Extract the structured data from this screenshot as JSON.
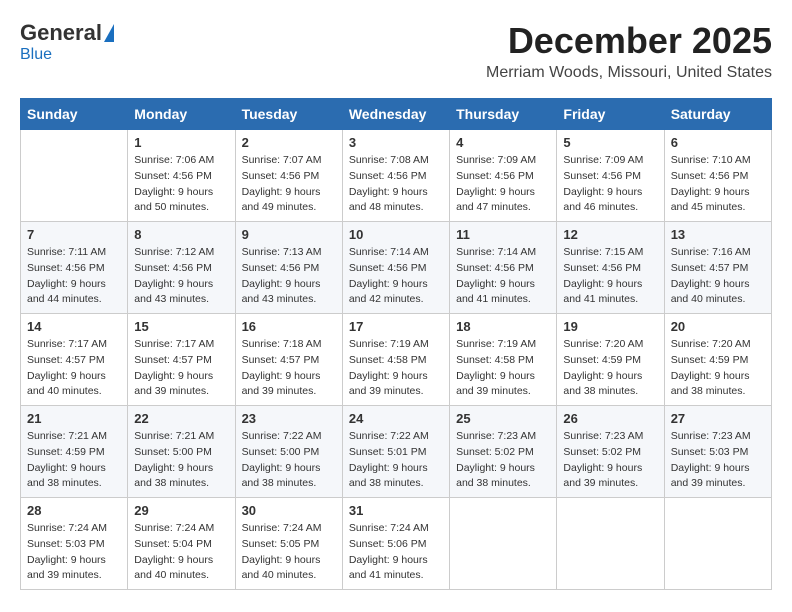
{
  "logo": {
    "general": "General",
    "blue": "Blue"
  },
  "title": {
    "month": "December 2025",
    "location": "Merriam Woods, Missouri, United States"
  },
  "days_of_week": [
    "Sunday",
    "Monday",
    "Tuesday",
    "Wednesday",
    "Thursday",
    "Friday",
    "Saturday"
  ],
  "weeks": [
    [
      {
        "day": "",
        "info": ""
      },
      {
        "day": "1",
        "info": "Sunrise: 7:06 AM\nSunset: 4:56 PM\nDaylight: 9 hours\nand 50 minutes."
      },
      {
        "day": "2",
        "info": "Sunrise: 7:07 AM\nSunset: 4:56 PM\nDaylight: 9 hours\nand 49 minutes."
      },
      {
        "day": "3",
        "info": "Sunrise: 7:08 AM\nSunset: 4:56 PM\nDaylight: 9 hours\nand 48 minutes."
      },
      {
        "day": "4",
        "info": "Sunrise: 7:09 AM\nSunset: 4:56 PM\nDaylight: 9 hours\nand 47 minutes."
      },
      {
        "day": "5",
        "info": "Sunrise: 7:09 AM\nSunset: 4:56 PM\nDaylight: 9 hours\nand 46 minutes."
      },
      {
        "day": "6",
        "info": "Sunrise: 7:10 AM\nSunset: 4:56 PM\nDaylight: 9 hours\nand 45 minutes."
      }
    ],
    [
      {
        "day": "7",
        "info": "Sunrise: 7:11 AM\nSunset: 4:56 PM\nDaylight: 9 hours\nand 44 minutes."
      },
      {
        "day": "8",
        "info": "Sunrise: 7:12 AM\nSunset: 4:56 PM\nDaylight: 9 hours\nand 43 minutes."
      },
      {
        "day": "9",
        "info": "Sunrise: 7:13 AM\nSunset: 4:56 PM\nDaylight: 9 hours\nand 43 minutes."
      },
      {
        "day": "10",
        "info": "Sunrise: 7:14 AM\nSunset: 4:56 PM\nDaylight: 9 hours\nand 42 minutes."
      },
      {
        "day": "11",
        "info": "Sunrise: 7:14 AM\nSunset: 4:56 PM\nDaylight: 9 hours\nand 41 minutes."
      },
      {
        "day": "12",
        "info": "Sunrise: 7:15 AM\nSunset: 4:56 PM\nDaylight: 9 hours\nand 41 minutes."
      },
      {
        "day": "13",
        "info": "Sunrise: 7:16 AM\nSunset: 4:57 PM\nDaylight: 9 hours\nand 40 minutes."
      }
    ],
    [
      {
        "day": "14",
        "info": "Sunrise: 7:17 AM\nSunset: 4:57 PM\nDaylight: 9 hours\nand 40 minutes."
      },
      {
        "day": "15",
        "info": "Sunrise: 7:17 AM\nSunset: 4:57 PM\nDaylight: 9 hours\nand 39 minutes."
      },
      {
        "day": "16",
        "info": "Sunrise: 7:18 AM\nSunset: 4:57 PM\nDaylight: 9 hours\nand 39 minutes."
      },
      {
        "day": "17",
        "info": "Sunrise: 7:19 AM\nSunset: 4:58 PM\nDaylight: 9 hours\nand 39 minutes."
      },
      {
        "day": "18",
        "info": "Sunrise: 7:19 AM\nSunset: 4:58 PM\nDaylight: 9 hours\nand 39 minutes."
      },
      {
        "day": "19",
        "info": "Sunrise: 7:20 AM\nSunset: 4:59 PM\nDaylight: 9 hours\nand 38 minutes."
      },
      {
        "day": "20",
        "info": "Sunrise: 7:20 AM\nSunset: 4:59 PM\nDaylight: 9 hours\nand 38 minutes."
      }
    ],
    [
      {
        "day": "21",
        "info": "Sunrise: 7:21 AM\nSunset: 4:59 PM\nDaylight: 9 hours\nand 38 minutes."
      },
      {
        "day": "22",
        "info": "Sunrise: 7:21 AM\nSunset: 5:00 PM\nDaylight: 9 hours\nand 38 minutes."
      },
      {
        "day": "23",
        "info": "Sunrise: 7:22 AM\nSunset: 5:00 PM\nDaylight: 9 hours\nand 38 minutes."
      },
      {
        "day": "24",
        "info": "Sunrise: 7:22 AM\nSunset: 5:01 PM\nDaylight: 9 hours\nand 38 minutes."
      },
      {
        "day": "25",
        "info": "Sunrise: 7:23 AM\nSunset: 5:02 PM\nDaylight: 9 hours\nand 38 minutes."
      },
      {
        "day": "26",
        "info": "Sunrise: 7:23 AM\nSunset: 5:02 PM\nDaylight: 9 hours\nand 39 minutes."
      },
      {
        "day": "27",
        "info": "Sunrise: 7:23 AM\nSunset: 5:03 PM\nDaylight: 9 hours\nand 39 minutes."
      }
    ],
    [
      {
        "day": "28",
        "info": "Sunrise: 7:24 AM\nSunset: 5:03 PM\nDaylight: 9 hours\nand 39 minutes."
      },
      {
        "day": "29",
        "info": "Sunrise: 7:24 AM\nSunset: 5:04 PM\nDaylight: 9 hours\nand 40 minutes."
      },
      {
        "day": "30",
        "info": "Sunrise: 7:24 AM\nSunset: 5:05 PM\nDaylight: 9 hours\nand 40 minutes."
      },
      {
        "day": "31",
        "info": "Sunrise: 7:24 AM\nSunset: 5:06 PM\nDaylight: 9 hours\nand 41 minutes."
      },
      {
        "day": "",
        "info": ""
      },
      {
        "day": "",
        "info": ""
      },
      {
        "day": "",
        "info": ""
      }
    ]
  ]
}
